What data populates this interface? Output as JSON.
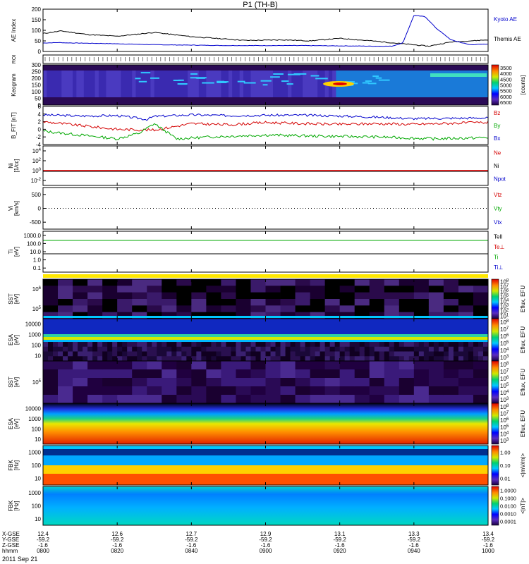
{
  "title": "P1 (TH-B)",
  "date": "2011 Sep 21",
  "colors": {
    "kyoto": "#0000cc",
    "themis": "#000000",
    "bz": "#d40000",
    "by": "#00a800",
    "bx": "#0000cc",
    "ne": "#d40000",
    "ni": "#000000",
    "npot": "#0000cc",
    "vtz": "#d40000",
    "vty": "#00a800",
    "vtx": "#0000cc",
    "tell": "#000000",
    "te_perp": "#d40000",
    "ti": "#00a800",
    "ti_perp": "#0000cc",
    "roi": "#ffe800"
  },
  "chart_data": [
    {
      "type": "line",
      "ylabel": "AE Index",
      "ylim": [
        0,
        200
      ],
      "yticks": [
        "0",
        "50",
        "100",
        "150",
        "200"
      ],
      "legend": [
        "Kyoto AE",
        "Themis AE"
      ],
      "series": [
        {
          "name": "Kyoto AE",
          "x": [
            0,
            4,
            8,
            16,
            30,
            50,
            70,
            90,
            94,
            97,
            100,
            103,
            106,
            110,
            115,
            120
          ],
          "values": [
            40,
            42,
            40,
            38,
            32,
            28,
            28,
            25,
            25,
            40,
            170,
            165,
            110,
            55,
            32,
            35
          ]
        },
        {
          "name": "Themis AE",
          "x": [
            0,
            5,
            12,
            20,
            30,
            40,
            55,
            65,
            72,
            80,
            90,
            96,
            104,
            110,
            120
          ],
          "values": [
            85,
            97,
            80,
            72,
            90,
            70,
            52,
            55,
            50,
            62,
            48,
            38,
            25,
            45,
            55
          ]
        }
      ]
    },
    {
      "type": "line",
      "ylabel": "ROI"
    },
    {
      "type": "heatmap",
      "ylabel": "Keogram",
      "ylim": [
        0,
        300
      ],
      "yticks": [
        "0",
        "50",
        "100",
        "150",
        "200",
        "250",
        "300"
      ],
      "colorbar": {
        "label": "[counts]",
        "ticks": [
          "3500",
          "4000",
          "4500",
          "5000",
          "5500",
          "6000",
          "6500"
        ]
      }
    },
    {
      "type": "line",
      "ylabel": "B_FIT [nT]",
      "ylim": [
        -4,
        6
      ],
      "yticks": [
        "-4",
        "-2",
        "0",
        "2",
        "4",
        "6"
      ],
      "legend": [
        "Bz",
        "By",
        "Bx"
      ],
      "series": [
        {
          "name": "Bz",
          "x": [
            0,
            10,
            20,
            30,
            40,
            50,
            60,
            70,
            80,
            90,
            100,
            110,
            120
          ],
          "values": [
            2.0,
            1.0,
            0.0,
            -0.2,
            1.5,
            1.2,
            1.8,
            1.5,
            1.3,
            1.5,
            1.3,
            1.6,
            1.8
          ]
        },
        {
          "name": "By",
          "x": [
            0,
            10,
            20,
            26,
            30,
            36,
            45,
            60,
            75,
            90,
            105,
            120
          ],
          "values": [
            -0.5,
            -1.5,
            -2.5,
            -1.0,
            1.5,
            -2.5,
            -2.0,
            -1.5,
            -1.8,
            -2.0,
            -2.5,
            -2.2
          ]
        },
        {
          "name": "Bx",
          "x": [
            0,
            10,
            20,
            28,
            30,
            40,
            50,
            60,
            70,
            80,
            90,
            100,
            110,
            120
          ],
          "values": [
            3.8,
            3.5,
            3.6,
            2.6,
            3.4,
            3.8,
            3.6,
            3.7,
            3.7,
            3.5,
            3.2,
            2.8,
            2.9,
            3.0
          ]
        }
      ]
    },
    {
      "type": "line",
      "ylabel": "Ni",
      "yunit": "[1/cc]",
      "ytick_labels": [
        {
          "base": "10",
          "exp": "4"
        },
        {
          "base": "10",
          "exp": "2"
        },
        {
          "base": "10",
          "exp": "0"
        },
        {
          "base": "10",
          "exp": "-2"
        }
      ],
      "legend": [
        "Ne",
        "Ni",
        "Npot"
      ]
    },
    {
      "type": "line",
      "ylabel": "Vi",
      "yunit": "[km/s]",
      "yticks": [
        "500",
        "0",
        "-500"
      ],
      "legend": [
        "Vtz",
        "Vty",
        "Vtx"
      ]
    },
    {
      "type": "line",
      "ylabel": "Ti",
      "yunit": "[eV]",
      "yticks": [
        "1000.0",
        "100.0",
        "10.0",
        "1.0",
        "0.1"
      ],
      "legend": [
        "Tell",
        "Te⊥",
        "Ti",
        "Ti⊥"
      ]
    },
    {
      "type": "heatmap",
      "ylabel": "SST",
      "yunit": "[eV]",
      "ytick_labels": [
        {
          "base": "10",
          "exp": "6"
        },
        {
          "base": "10",
          "exp": "5"
        }
      ],
      "colorbar": {
        "label": "Eflux, EFU",
        "ticks": [
          {
            "base": "10",
            "exp": "8"
          },
          {
            "base": "10",
            "exp": "7"
          },
          {
            "base": "10",
            "exp": "6"
          },
          {
            "base": "10",
            "exp": "5"
          },
          {
            "base": "10",
            "exp": "4"
          },
          {
            "base": "10",
            "exp": "3"
          },
          {
            "base": "10",
            "exp": "2"
          },
          {
            "base": "10",
            "exp": "1"
          }
        ]
      }
    },
    {
      "type": "heatmap",
      "ylabel": "ESA",
      "yunit": "[eV]",
      "yticks": [
        "10000",
        "1000",
        "100",
        "10"
      ],
      "colorbar": {
        "label": "Eflux, EFU",
        "ticks": [
          {
            "base": "10",
            "exp": "8"
          },
          {
            "base": "10",
            "exp": "7"
          },
          {
            "base": "10",
            "exp": "6"
          },
          {
            "base": "10",
            "exp": "5"
          },
          {
            "base": "10",
            "exp": "4"
          },
          {
            "base": "10",
            "exp": "3"
          }
        ]
      }
    },
    {
      "type": "heatmap",
      "ylabel": "SST",
      "yunit": "[eV]",
      "ytick_labels": [
        {
          "base": "10",
          "exp": "5"
        }
      ],
      "colorbar": {
        "label": "Eflux, EFU",
        "ticks": [
          {
            "base": "10",
            "exp": "8"
          },
          {
            "base": "10",
            "exp": "7"
          },
          {
            "base": "10",
            "exp": "6"
          },
          {
            "base": "10",
            "exp": "5"
          },
          {
            "base": "10",
            "exp": "4"
          },
          {
            "base": "10",
            "exp": "3"
          }
        ]
      }
    },
    {
      "type": "heatmap",
      "ylabel": "ESA",
      "yunit": "[eV]",
      "yticks": [
        "10000",
        "1000",
        "100",
        "10"
      ],
      "colorbar": {
        "label": "Eflux, EFU",
        "ticks": [
          {
            "base": "10",
            "exp": "8"
          },
          {
            "base": "10",
            "exp": "7"
          },
          {
            "base": "10",
            "exp": "6"
          },
          {
            "base": "10",
            "exp": "5"
          },
          {
            "base": "10",
            "exp": "4"
          },
          {
            "base": "10",
            "exp": "3"
          }
        ]
      }
    },
    {
      "type": "heatmap",
      "ylabel": "FBK",
      "yunit": "[Hz]",
      "yticks": [
        "1000",
        "100",
        "10"
      ],
      "colorbar": {
        "label": "<|mV/m|>",
        "ticks": [
          "1.00",
          "0.10",
          "0.01"
        ]
      }
    },
    {
      "type": "heatmap",
      "ylabel": "FBK",
      "yunit": "[Hz]",
      "yticks": [
        "1000",
        "100",
        "10"
      ],
      "colorbar": {
        "label": "<|nT|>",
        "ticks": [
          "1.0000",
          "0.1000",
          "0.0100",
          "0.0010",
          "0.0001"
        ]
      }
    }
  ],
  "x_axis": {
    "row_labels": [
      "X-GSE",
      "Y-GSE",
      "Z-GSE",
      "hhmm"
    ],
    "ticks": [
      {
        "minute": 0,
        "values": [
          "12.4",
          "-59.2",
          "-1.6",
          "0800"
        ]
      },
      {
        "minute": 20,
        "values": [
          "12.6",
          "-59.2",
          "-1.6",
          "0820"
        ]
      },
      {
        "minute": 40,
        "values": [
          "12.7",
          "-59.2",
          "-1.6",
          "0840"
        ]
      },
      {
        "minute": 60,
        "values": [
          "12.9",
          "-59.2",
          "-1.6",
          "0900"
        ]
      },
      {
        "minute": 80,
        "values": [
          "13.1",
          "-59.2",
          "-1.6",
          "0920"
        ]
      },
      {
        "minute": 100,
        "values": [
          "13.3",
          "-59.2",
          "-1.6",
          "0940"
        ]
      },
      {
        "minute": 120,
        "values": [
          "13.4",
          "-59.2",
          "-1.6",
          "1000"
        ]
      }
    ],
    "xlim": [
      0,
      120
    ]
  }
}
